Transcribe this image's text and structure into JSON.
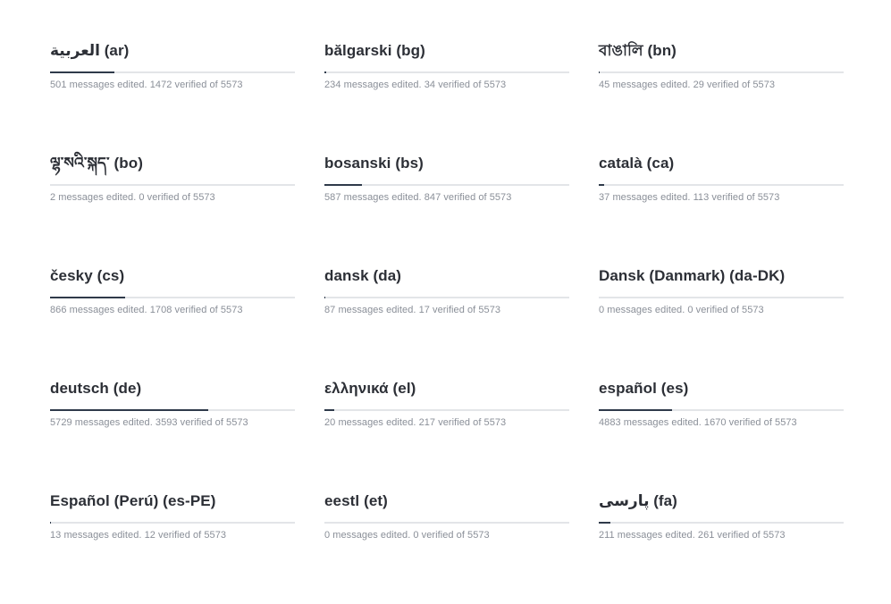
{
  "languages": [
    {
      "title": "العربية (ar)",
      "edited": 501,
      "verified": 1472,
      "total": 5573
    },
    {
      "title": "bălgarski (bg)",
      "edited": 234,
      "verified": 34,
      "total": 5573
    },
    {
      "title": "বাঙালি (bn)",
      "edited": 45,
      "verified": 29,
      "total": 5573
    },
    {
      "title": "ལྷ་སའི་སྐད་ (bo)",
      "edited": 2,
      "verified": 0,
      "total": 5573
    },
    {
      "title": "bosanski (bs)",
      "edited": 587,
      "verified": 847,
      "total": 5573
    },
    {
      "title": "català (ca)",
      "edited": 37,
      "verified": 113,
      "total": 5573
    },
    {
      "title": "česky (cs)",
      "edited": 866,
      "verified": 1708,
      "total": 5573
    },
    {
      "title": "dansk (da)",
      "edited": 87,
      "verified": 17,
      "total": 5573
    },
    {
      "title": "Dansk (Danmark) (da-DK)",
      "edited": 0,
      "verified": 0,
      "total": 5573
    },
    {
      "title": "deutsch (de)",
      "edited": 5729,
      "verified": 3593,
      "total": 5573
    },
    {
      "title": "ελληνικά (el)",
      "edited": 20,
      "verified": 217,
      "total": 5573
    },
    {
      "title": "español (es)",
      "edited": 4883,
      "verified": 1670,
      "total": 5573
    },
    {
      "title": "Español (Perú) (es-PE)",
      "edited": 13,
      "verified": 12,
      "total": 5573
    },
    {
      "title": "eestl (et)",
      "edited": 0,
      "verified": 0,
      "total": 5573
    },
    {
      "title": "پارسی (fa)",
      "edited": 211,
      "verified": 261,
      "total": 5573
    }
  ],
  "stats_template": {
    "edited_suffix": " messages edited. ",
    "verified_middle": " verified of "
  },
  "colors": {
    "progress_fill": "#2f3a4a",
    "progress_track": "#e3e5e8",
    "title_text": "#2c2f36",
    "stats_text": "#8a8f98"
  }
}
